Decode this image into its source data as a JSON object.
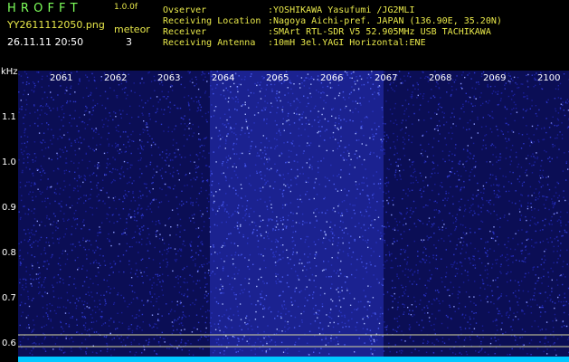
{
  "header": {
    "title": "H R O F F T",
    "version": "1.0.0f",
    "file": "YY2611112050.png",
    "datetime": "26.11.11 20:50",
    "mode_label": "meteor",
    "meteor_count": "3"
  },
  "info": [
    {
      "label": "Ovserver",
      "value": ":YOSHIKAWA Yasufumi /JG2MLI"
    },
    {
      "label": "Receiving Location",
      "value": ":Nagoya Aichi-pref. JAPAN (136.90E, 35.20N)"
    },
    {
      "label": "Receiver",
      "value": ":SMArt RTL-SDR V5 52.905MHz USB TACHIKAWA"
    },
    {
      "label": "Receiving Antenna",
      "value": ":10mH 3el.YAGI Horizontal:ENE"
    }
  ],
  "axis": {
    "unit": "kHz",
    "time_ticks": [
      "2061",
      "2062",
      "2063",
      "2064",
      "2065",
      "2066",
      "2067",
      "2068",
      "2069",
      "2100"
    ],
    "freq_ticks": [
      "1.1",
      "1.0",
      "0.9",
      "0.8",
      "0.7",
      "0.6"
    ]
  },
  "colors": {
    "background": "#000000",
    "noise": "#1a1f9a",
    "highlight": "#a9b8ff",
    "label_yellow": "#e8e84a",
    "label_green": "#7dff5a",
    "baseline": "#00c8ff"
  }
}
